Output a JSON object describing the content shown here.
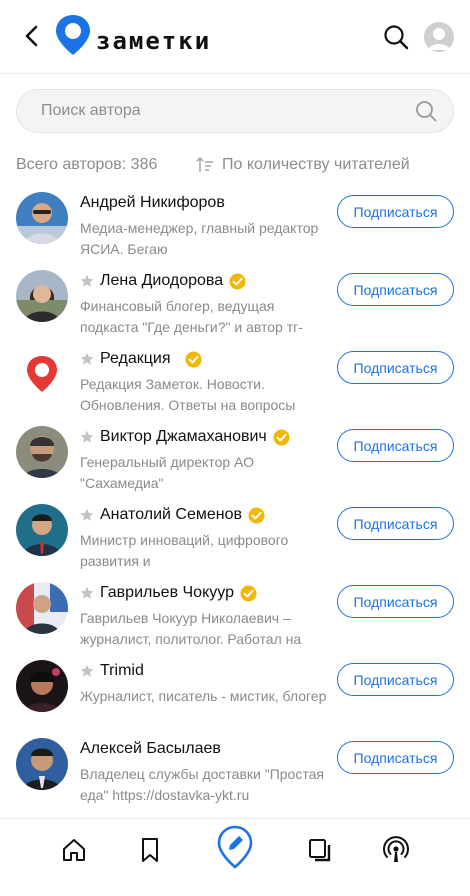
{
  "app": {
    "logo_text": "заметки",
    "brand_color": "#1a73e8",
    "accent_verified": "#f2b705",
    "logo_icon": "pin-logo-icon"
  },
  "search": {
    "placeholder": "Поиск автора",
    "value": ""
  },
  "summary": {
    "total_label": "Всего авторов: 386",
    "sort_label": "По количеству читателей"
  },
  "authors": [
    {
      "name": "Андрей Никифоров",
      "starred": false,
      "verified": false,
      "description": "Медиа-менеджер, главный редактор ЯСИА. Бегаю",
      "button": "Подписаться"
    },
    {
      "name": "Лена Диодорова",
      "starred": true,
      "verified": true,
      "description": "Финансовый блогер, ведущая подкаста \"Где деньги?\" и автор тг-",
      "button": "Подписаться"
    },
    {
      "name": "Редакция",
      "starred": true,
      "verified": true,
      "description": "Редакция Заметок. Новости. Обновления. Ответы на вопросы",
      "button": "Подписаться"
    },
    {
      "name": "Виктор Джамаханович",
      "starred": true,
      "verified": true,
      "description": "Генеральный директор АО \"Сахамедиа\"",
      "button": "Подписаться"
    },
    {
      "name": "Анатолий Семенов",
      "starred": true,
      "verified": true,
      "description": "Министр инноваций, цифрового развития и",
      "button": "Подписаться"
    },
    {
      "name": "Гаврильев Чокуур",
      "starred": true,
      "verified": true,
      "description": "Гаврильев Чокуур Николаевич – журналист, политолог. Работал на",
      "button": "Подписаться"
    },
    {
      "name": "Trimid",
      "starred": true,
      "verified": false,
      "description": "Журналист, писатель - мистик, блогер",
      "button": "Подписаться"
    },
    {
      "name": "Алексей Басылаев",
      "starred": false,
      "verified": false,
      "description": "Владелец службы доставки \"Простая еда\" https://dostavka-ykt.ru",
      "button": "Подписаться"
    }
  ],
  "bottom_nav": [
    "home-icon",
    "bookmark-icon",
    "write-icon",
    "copy-icon",
    "podcast-icon"
  ]
}
